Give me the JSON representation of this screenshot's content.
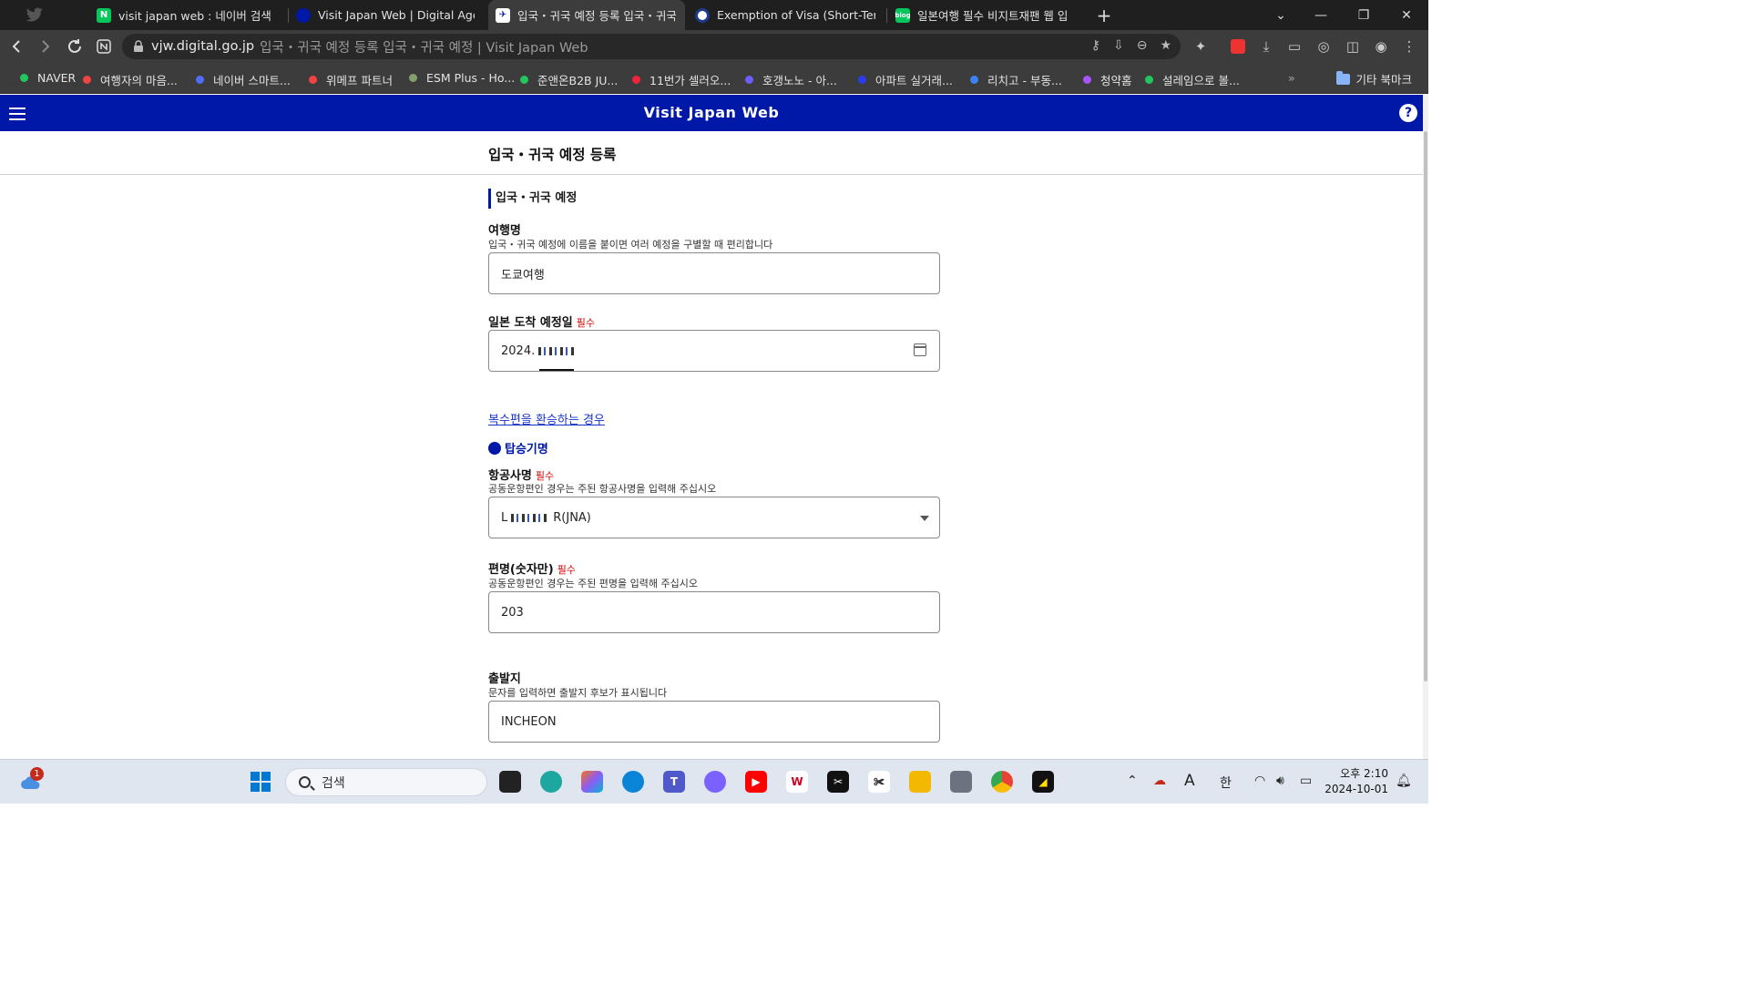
{
  "tabs": [
    {
      "title": "visit japan web : 네이버 검색",
      "favicon": "naver-icon",
      "active": false
    },
    {
      "title": "Visit Japan Web | Digital Agency",
      "favicon": "vjw-icon",
      "active": false
    },
    {
      "title": "입국・귀국 예정 등록 입국・귀국",
      "favicon": "vjw-flight-icon",
      "active": true
    },
    {
      "title": "Exemption of Visa (Short-Term S",
      "favicon": "mofa-icon",
      "active": false
    },
    {
      "title": "일본여행 필수 비지트재팬 웹 입",
      "favicon": "blog-icon",
      "active": false
    }
  ],
  "address_bar": {
    "host": "vjw.digital.go.jp",
    "page_title": "입국・귀국 예정 등록 입국・귀국 예정 | Visit Japan Web"
  },
  "bookmarks": [
    {
      "label": "NAVER",
      "color": "#22c55e"
    },
    {
      "label": "여행자의 마음...",
      "color": "#ef4444"
    },
    {
      "label": "네이버 스마트...",
      "color": "#4f6ef7"
    },
    {
      "label": "위메프 파트너",
      "color": "#ef4444"
    },
    {
      "label": "ESM Plus - Ho...",
      "color": "#84a06a"
    },
    {
      "label": "준앤온B2B JU...",
      "color": "#22c55e"
    },
    {
      "label": "11번가 셀러오...",
      "color": "#ef233c"
    },
    {
      "label": "호갱노노 - 아...",
      "color": "#6d5dfc"
    },
    {
      "label": "아파트 실거래...",
      "color": "#2a3cf0"
    },
    {
      "label": "리치고 - 부동...",
      "color": "#3b82f6"
    },
    {
      "label": "청약홈",
      "color": "#a855f7"
    },
    {
      "label": "설레임으로 볼...",
      "color": "#22c55e"
    }
  ],
  "bookmarks_folder": "기타 북마크",
  "header": {
    "title": "Visit Japan Web",
    "help": "?"
  },
  "page": {
    "title": "입국・귀국 예정 등록",
    "section": "입국・귀국 예정",
    "trip_name": {
      "label": "여행명",
      "hint": "입국・귀국 예정에 이름을 붙이면 여러 예정을 구별할 때 편리합니다",
      "value": "도쿄여행"
    },
    "arrival_date": {
      "label": "일본 도착 예정일",
      "required": "필수",
      "value": "2024."
    },
    "transfer_link": "복수편을 환승하는 경우",
    "flight_section": "탑승기명",
    "airline": {
      "label": "항공사명",
      "required": "필수",
      "hint": "공동운항편인 경우는 주된 항공사명을 입력해 주십시오",
      "value_prefix": "L",
      "value_suffix": "R(JNA)"
    },
    "flight_number": {
      "label": "편명(숫자만)",
      "required": "필수",
      "hint": "공동운항편인 경우는 주된 편명을 입력해 주십시오",
      "value": "203"
    },
    "departure": {
      "label": "출발지",
      "hint": "문자를 입력하면 출발지 후보가 표시됩니다",
      "value": "INCHEON"
    }
  },
  "taskbar": {
    "search_placeholder": "검색",
    "weather_badge": "1",
    "ime": "한",
    "font_indicator": "A",
    "time": "오후 2:10",
    "date": "2024-10-01"
  },
  "colors": {
    "brand_blue": "#0018a8",
    "required_red": "#d00000",
    "link_blue": "#1a33c8"
  }
}
